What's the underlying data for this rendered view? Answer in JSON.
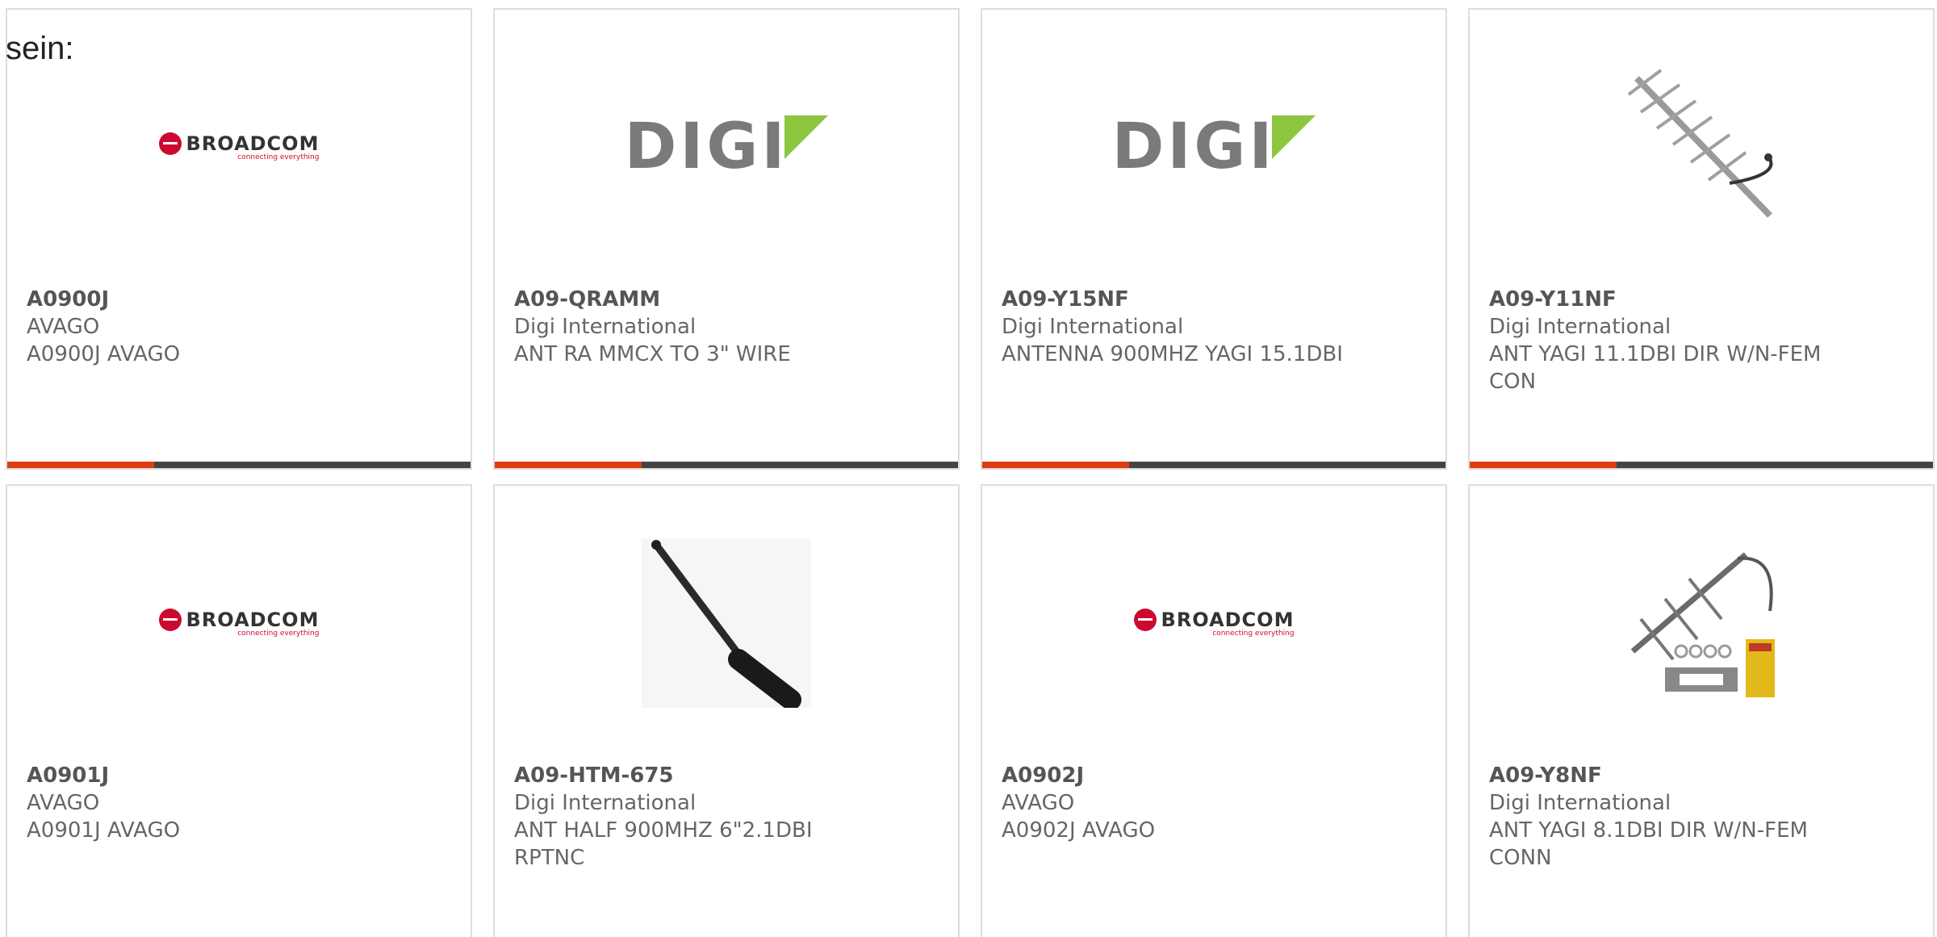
{
  "intro_text": "sein:",
  "brands": {
    "broadcom_word": "BROADCOM",
    "broadcom_tagline": "connecting everything",
    "digi_word": "DIGI"
  },
  "colors": {
    "accent": "#dd3d10",
    "bar": "#444444",
    "digi_green": "#8dc63f",
    "broadcom_red": "#cc092f"
  },
  "products": [
    {
      "part_number": "A0900J",
      "manufacturer": "AVAGO",
      "description": "A0900J AVAGO",
      "image": "broadcom-logo"
    },
    {
      "part_number": "A09-QRAMM",
      "manufacturer": "Digi International",
      "description": "ANT RA MMCX TO 3\" WIRE",
      "image": "digi-logo"
    },
    {
      "part_number": "A09-Y15NF",
      "manufacturer": "Digi International",
      "description": "ANTENNA 900MHZ YAGI 15.1DBI",
      "image": "digi-logo"
    },
    {
      "part_number": "A09-Y11NF",
      "manufacturer": "Digi International",
      "description": "ANT YAGI 11.1DBI DIR W/N-FEM CON",
      "image": "yagi-antenna-photo"
    },
    {
      "part_number": "A0901J",
      "manufacturer": "AVAGO",
      "description": "A0901J AVAGO",
      "image": "broadcom-logo"
    },
    {
      "part_number": "A09-HTM-675",
      "manufacturer": "Digi International",
      "description": "ANT HALF 900MHZ 6\"2.1DBI RPTNC",
      "image": "whip-antenna-photo"
    },
    {
      "part_number": "A0902J",
      "manufacturer": "AVAGO",
      "description": "A0902J AVAGO",
      "image": "broadcom-logo"
    },
    {
      "part_number": "A09-Y8NF",
      "manufacturer": "Digi International",
      "description": "ANT YAGI 8.1DBI DIR W/N-FEM CONN",
      "image": "yagi-kit-photo"
    }
  ]
}
